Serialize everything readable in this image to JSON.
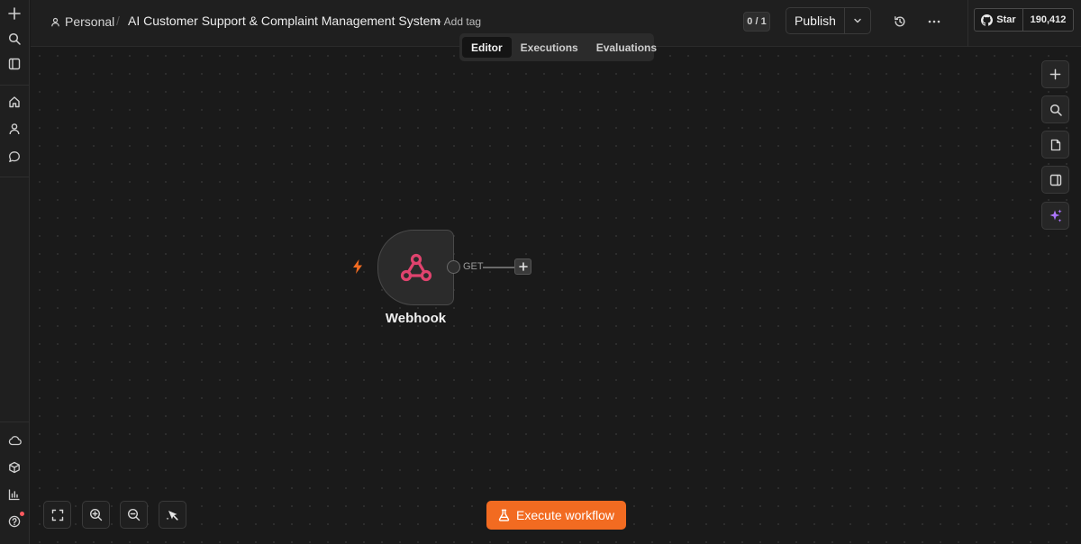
{
  "colors": {
    "accent": "#f26b21",
    "webhook_icon": "#e0436e",
    "trigger_bolt": "#f26b21",
    "background": "#1a1a1a"
  },
  "sidebar": {
    "top_items": [
      {
        "name": "create",
        "icon": "plus-icon"
      },
      {
        "name": "search",
        "icon": "search-icon"
      },
      {
        "name": "toggle-panel",
        "icon": "panel-icon"
      }
    ],
    "nav_items": [
      {
        "name": "overview",
        "icon": "home-icon"
      },
      {
        "name": "personal",
        "icon": "user-icon"
      },
      {
        "name": "chat",
        "icon": "chat-icon"
      }
    ],
    "bottom_items": [
      {
        "name": "cloud",
        "icon": "cloud-icon"
      },
      {
        "name": "templates",
        "icon": "box-icon"
      },
      {
        "name": "insights",
        "icon": "bar-chart-icon"
      },
      {
        "name": "help",
        "icon": "help-icon",
        "notification": true
      }
    ]
  },
  "header": {
    "breadcrumb_project": "Personal",
    "breadcrumb_separator": "/",
    "workflow_title": "AI Customer Support & Complaint Management System",
    "add_tag_label": "+ Add tag",
    "counter": "0 / 1",
    "publish_label": "Publish",
    "github_star_label": "Star",
    "github_star_count": "190,412"
  },
  "tabs": [
    {
      "label": "Editor",
      "active": true
    },
    {
      "label": "Executions",
      "active": false
    },
    {
      "label": "Evaluations",
      "active": false
    }
  ],
  "canvas": {
    "node": {
      "name": "Webhook",
      "icon": "webhook-icon",
      "is_trigger": true,
      "output_label": "GET"
    },
    "right_toolbar": [
      {
        "name": "add-node",
        "icon": "plus-icon"
      },
      {
        "name": "search-nodes",
        "icon": "search-icon"
      },
      {
        "name": "sticky-note",
        "icon": "note-icon"
      },
      {
        "name": "toggle-side-panel",
        "icon": "panel-right-icon"
      },
      {
        "name": "ai-assistant",
        "icon": "sparkle-icon"
      }
    ],
    "zoom_controls": [
      {
        "name": "fit-view",
        "icon": "fit-view-icon"
      },
      {
        "name": "zoom-in",
        "icon": "zoom-in-icon"
      },
      {
        "name": "zoom-out",
        "icon": "zoom-out-icon"
      },
      {
        "name": "tidy-up",
        "icon": "magic-cursor-icon"
      }
    ],
    "execute_label": "Execute workflow"
  }
}
